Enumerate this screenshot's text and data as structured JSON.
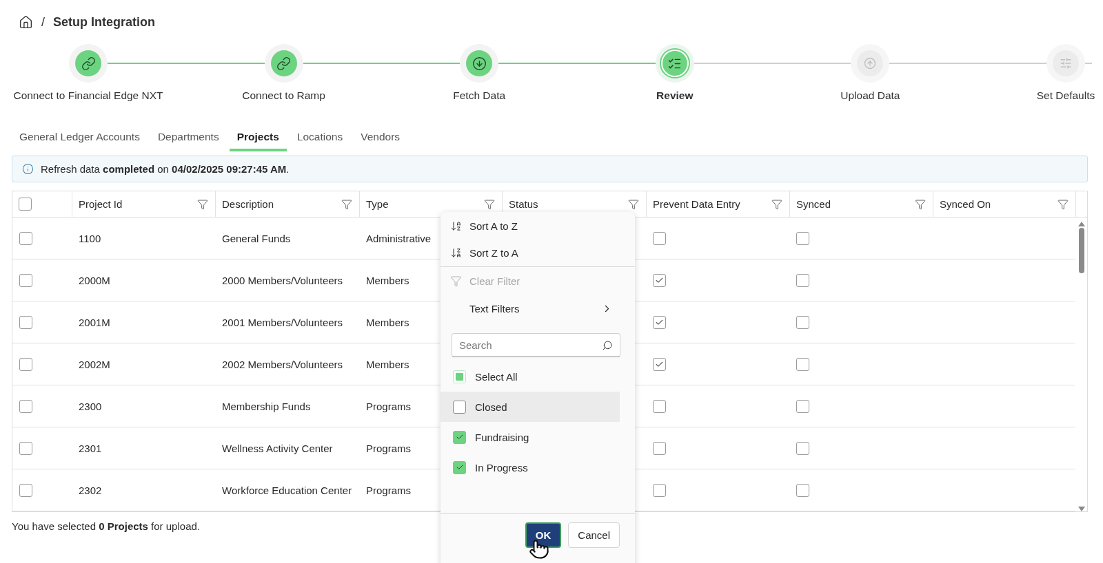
{
  "breadcrumb": {
    "separator": "/",
    "title": "Setup Integration"
  },
  "steps": [
    {
      "label": "Connect to Financial Edge NXT",
      "completed": true,
      "current": false
    },
    {
      "label": "Connect to Ramp",
      "completed": true,
      "current": false
    },
    {
      "label": "Fetch Data",
      "completed": true,
      "current": false
    },
    {
      "label": "Review",
      "completed": false,
      "current": true
    },
    {
      "label": "Upload Data",
      "completed": false,
      "current": false
    },
    {
      "label": "Set Defaults",
      "completed": false,
      "current": false
    }
  ],
  "tabs": [
    {
      "label": "General Ledger Accounts",
      "selected": false
    },
    {
      "label": "Departments",
      "selected": false
    },
    {
      "label": "Projects",
      "selected": true
    },
    {
      "label": "Locations",
      "selected": false
    },
    {
      "label": "Vendors",
      "selected": false
    }
  ],
  "info_bar": {
    "text": "Refresh data **completed** on **04/02/2025 09:27:45 AM**."
  },
  "table": {
    "select_all_checked": false,
    "columns": [
      "Project Id",
      "Description",
      "Type",
      "Status",
      "Prevent Data Entry",
      "Synced",
      "Synced On"
    ],
    "rows": [
      {
        "selected": false,
        "project_id": "1100",
        "description": "General Funds",
        "type": "Administrative",
        "prevent_data_entry": false,
        "synced": false
      },
      {
        "selected": false,
        "project_id": "2000M",
        "description": "2000 Members/Volunteers",
        "type": "Members",
        "prevent_data_entry": true,
        "synced": false
      },
      {
        "selected": false,
        "project_id": "2001M",
        "description": "2001 Members/Volunteers",
        "type": "Members",
        "prevent_data_entry": true,
        "synced": false
      },
      {
        "selected": false,
        "project_id": "2002M",
        "description": "2002 Members/Volunteers",
        "type": "Members",
        "prevent_data_entry": true,
        "synced": false
      },
      {
        "selected": false,
        "project_id": "2300",
        "description": "Membership Funds",
        "type": "Programs",
        "prevent_data_entry": false,
        "synced": false
      },
      {
        "selected": false,
        "project_id": "2301",
        "description": "Wellness Activity Center",
        "type": "Programs",
        "prevent_data_entry": false,
        "synced": false
      },
      {
        "selected": false,
        "project_id": "2302",
        "description": "Workforce Education Center",
        "type": "Programs",
        "prevent_data_entry": false,
        "synced": false
      }
    ]
  },
  "footer": {
    "text": "You have selected **0 Projects** for upload."
  },
  "filter_menu": {
    "actions": [
      {
        "label": "Sort A to Z",
        "kind": "sort-asc",
        "disabled": false
      },
      {
        "label": "Sort Z to A",
        "kind": "sort-desc",
        "disabled": false
      },
      {
        "label": "Clear Filter",
        "kind": "clear",
        "disabled": true
      },
      {
        "label": "Text Filters",
        "kind": "submenu",
        "disabled": false
      }
    ],
    "search": {
      "placeholder": "Search"
    },
    "options": [
      {
        "label": "Select All",
        "checked": false,
        "indeterminate": true,
        "hovered": false
      },
      {
        "label": "Closed",
        "checked": false,
        "hovered": true
      },
      {
        "label": "Fundraising",
        "checked": true,
        "hovered": false
      },
      {
        "label": "In Progress",
        "checked": true,
        "hovered": false
      }
    ],
    "buttons": [
      {
        "label": "OK",
        "primary": true
      },
      {
        "label": "Cancel",
        "primary": false
      }
    ]
  }
}
